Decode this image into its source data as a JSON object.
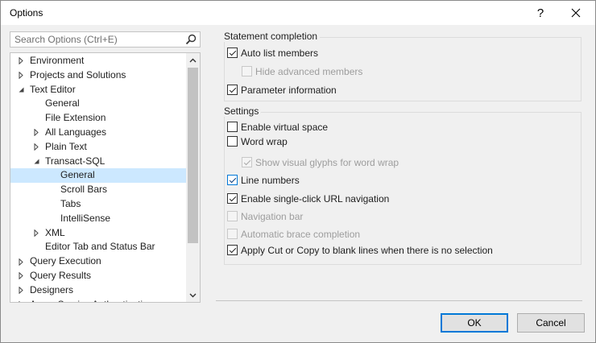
{
  "window": {
    "title": "Options",
    "help_glyph": "?",
    "close_glyph": "✕"
  },
  "search": {
    "placeholder": "Search Options (Ctrl+E)",
    "value": ""
  },
  "tree": {
    "items": [
      {
        "label": "Environment",
        "level": 0,
        "expander": "collapsed"
      },
      {
        "label": "Projects and Solutions",
        "level": 0,
        "expander": "collapsed"
      },
      {
        "label": "Text Editor",
        "level": 0,
        "expander": "expanded"
      },
      {
        "label": "General",
        "level": 1,
        "expander": "none"
      },
      {
        "label": "File Extension",
        "level": 1,
        "expander": "none"
      },
      {
        "label": "All Languages",
        "level": 1,
        "expander": "collapsed"
      },
      {
        "label": "Plain Text",
        "level": 1,
        "expander": "collapsed"
      },
      {
        "label": "Transact-SQL",
        "level": 1,
        "expander": "expanded"
      },
      {
        "label": "General",
        "level": 2,
        "expander": "none",
        "selected": true
      },
      {
        "label": "Scroll Bars",
        "level": 2,
        "expander": "none"
      },
      {
        "label": "Tabs",
        "level": 2,
        "expander": "none"
      },
      {
        "label": "IntelliSense",
        "level": 2,
        "expander": "none"
      },
      {
        "label": "XML",
        "level": 1,
        "expander": "collapsed"
      },
      {
        "label": "Editor Tab and Status Bar",
        "level": 1,
        "expander": "none"
      },
      {
        "label": "Query Execution",
        "level": 0,
        "expander": "collapsed"
      },
      {
        "label": "Query Results",
        "level": 0,
        "expander": "collapsed"
      },
      {
        "label": "Designers",
        "level": 0,
        "expander": "collapsed"
      },
      {
        "label": "Azure Service Authentication",
        "level": 0,
        "expander": "collapsed"
      }
    ]
  },
  "statement_completion": {
    "legend": "Statement completion",
    "options": [
      {
        "label": "Auto list members",
        "checked": true,
        "enabled": true,
        "indent": 0
      },
      {
        "label": "Hide advanced members",
        "checked": false,
        "enabled": false,
        "indent": 1
      },
      {
        "label": "Parameter information",
        "checked": true,
        "enabled": true,
        "indent": 0
      }
    ]
  },
  "settings": {
    "legend": "Settings",
    "options": [
      {
        "label": "Enable virtual space",
        "checked": false,
        "enabled": true,
        "indent": 0
      },
      {
        "label": "Word wrap",
        "checked": false,
        "enabled": true,
        "indent": 0
      },
      {
        "label": "Show visual glyphs for word wrap",
        "checked": true,
        "enabled": false,
        "indent": 1
      },
      {
        "label": "Line numbers",
        "checked": true,
        "enabled": true,
        "indent": 0,
        "focused": true
      },
      {
        "label": "Enable single-click URL navigation",
        "checked": true,
        "enabled": true,
        "indent": 0
      },
      {
        "label": "Navigation bar",
        "checked": false,
        "enabled": false,
        "indent": 0
      },
      {
        "label": "Automatic brace completion",
        "checked": false,
        "enabled": false,
        "indent": 0
      },
      {
        "label": "Apply Cut or Copy to blank lines when there is no selection",
        "checked": true,
        "enabled": true,
        "indent": 0
      }
    ]
  },
  "buttons": {
    "ok_label": "OK",
    "cancel_label": "Cancel"
  },
  "colors": {
    "selection": "#cce8ff",
    "accent": "#0078d7",
    "dialog_bg": "#f0f0f0"
  }
}
